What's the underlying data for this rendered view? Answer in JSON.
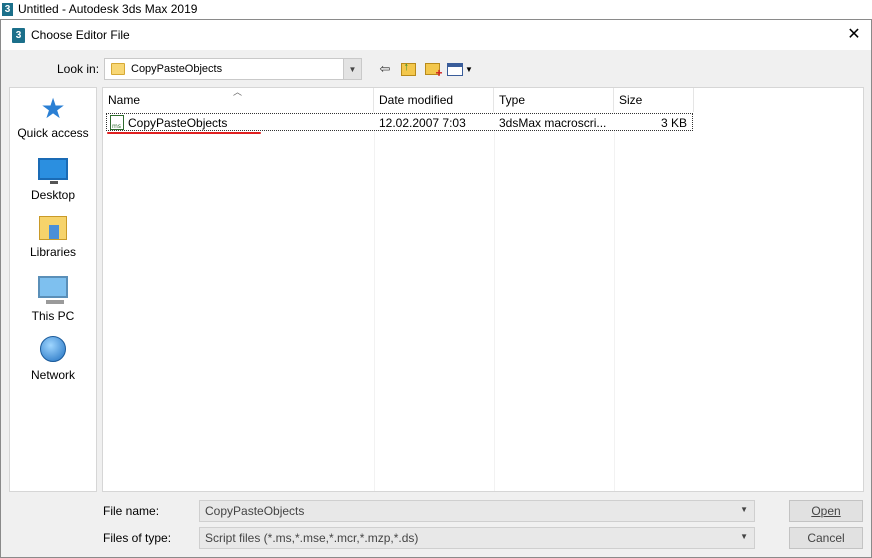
{
  "app": {
    "title": "Untitled - Autodesk 3ds Max 2019",
    "icon": "3ds-max-icon"
  },
  "dialog": {
    "title": "Choose Editor File",
    "close_glyph": "✕",
    "look_in": {
      "label": "Look in:",
      "value": "CopyPasteObjects"
    },
    "places": [
      {
        "label": "Quick access",
        "icon": "star-icon"
      },
      {
        "label": "Desktop",
        "icon": "desktop-icon"
      },
      {
        "label": "Libraries",
        "icon": "libraries-icon"
      },
      {
        "label": "This PC",
        "icon": "computer-icon"
      },
      {
        "label": "Network",
        "icon": "network-icon"
      }
    ],
    "columns": {
      "name": "Name",
      "date": "Date modified",
      "type": "Type",
      "size": "Size"
    },
    "files": [
      {
        "name": "CopyPasteObjects",
        "date": "12.02.2007 7:03",
        "type": "3dsMax macroscri...",
        "size": "3 KB",
        "icon": "maxscript-file-icon"
      }
    ],
    "file_name": {
      "label": "File name:",
      "value": "CopyPasteObjects"
    },
    "file_type": {
      "label": "Files of type:",
      "value": "Script files (*.ms,*.mse,*.mcr,*.mzp,*.ds)"
    },
    "buttons": {
      "open": "Open",
      "cancel": "Cancel"
    }
  },
  "colors": {
    "annotation_underline": "#e02020",
    "selection_border": "#333333"
  }
}
